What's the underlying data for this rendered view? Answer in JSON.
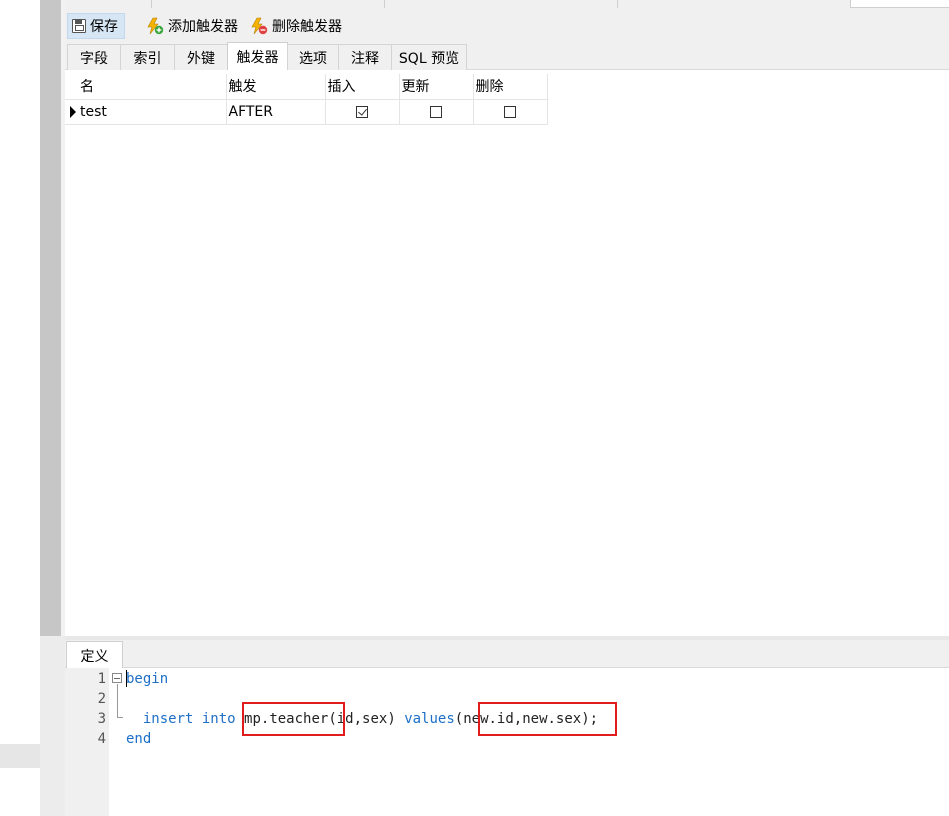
{
  "toolbar": {
    "save_label": "保存",
    "add_trigger_label": "添加触发器",
    "delete_trigger_label": "删除触发器"
  },
  "tabs": [
    {
      "label": "字段",
      "active": false
    },
    {
      "label": "索引",
      "active": false
    },
    {
      "label": "外键",
      "active": false
    },
    {
      "label": "触发器",
      "active": true
    },
    {
      "label": "选项",
      "active": false
    },
    {
      "label": "注释",
      "active": false
    },
    {
      "label": "SQL 预览",
      "active": false
    }
  ],
  "grid": {
    "columns": [
      "名",
      "触发",
      "插入",
      "更新",
      "删除"
    ],
    "rows": [
      {
        "name": "test",
        "trigger": "AFTER",
        "insert": true,
        "update": false,
        "delete": false
      }
    ]
  },
  "definition": {
    "tab_label": "定义",
    "line_numbers": [
      "1",
      "2",
      "3",
      "4"
    ],
    "lines": {
      "l1_kw": "begin",
      "l3_indent": "  ",
      "l3_kw1": "insert",
      "l3_kw2": "into",
      "l3_table": "mp.teacher",
      "l3_cols": "(id,sex)",
      "l3_kw3": "values",
      "l3_values": "(new.id,new.sex)",
      "l3_end": ";",
      "l4_kw": "end"
    }
  },
  "colors": {
    "keyword": "#1d6fc7",
    "highlight_box": "#e01c1c",
    "save_button_bg": "#d6e6f4"
  }
}
